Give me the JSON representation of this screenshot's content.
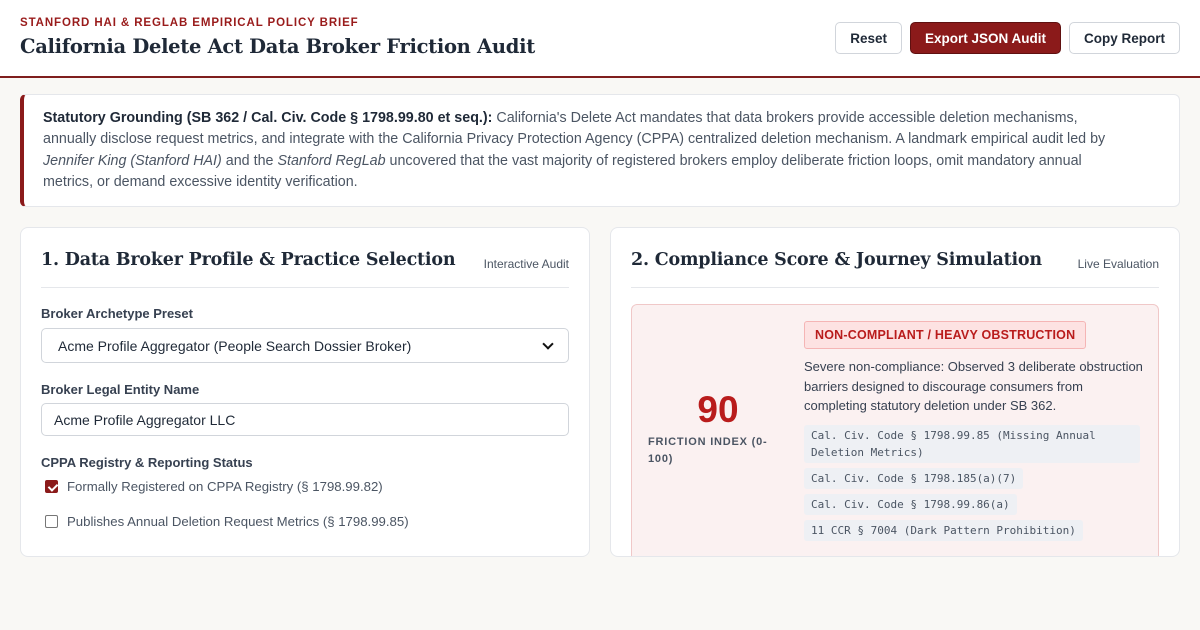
{
  "header": {
    "eyebrow": "STANFORD HAI & REGLAB EMPIRICAL POLICY BRIEF",
    "title": "California Delete Act Data Broker Friction Audit",
    "actions": {
      "reset": "Reset",
      "export": "Export JSON Audit",
      "copy": "Copy Report"
    }
  },
  "grounding": {
    "lead": "Statutory Grounding (SB 362 / Cal. Civ. Code § 1798.99.80 et seq.):",
    "text_1": " California's Delete Act mandates that data brokers provide accessible deletion mechanisms, annually disclose request metrics, and integrate with the California Privacy Protection Agency (CPPA) centralized deletion mechanism. A landmark empirical audit led by ",
    "person": "Jennifer King (Stanford HAI)",
    "text_2": " and the ",
    "lab": "Stanford RegLab",
    "text_3": " uncovered that the vast majority of registered brokers employ deliberate friction loops, omit mandatory annual metrics, or demand excessive identity verification."
  },
  "left_panel": {
    "title": "1. Data Broker Profile & Practice Selection",
    "tag": "Interactive Audit",
    "preset_label": "Broker Archetype Preset",
    "preset_value": "Acme Profile Aggregator (People Search Dossier Broker)",
    "entity_label": "Broker Legal Entity Name",
    "entity_value": "Acme Profile Aggregator LLC",
    "registry_label": "CPPA Registry & Reporting Status",
    "checks": [
      {
        "label": "Formally Registered on CPPA Registry (§ 1798.99.82)",
        "checked": true
      },
      {
        "label": "Publishes Annual Deletion Request Metrics (§ 1798.99.85)",
        "checked": false
      }
    ]
  },
  "right_panel": {
    "title": "2. Compliance Score & Journey Simulation",
    "tag": "Live Evaluation",
    "score": "90",
    "score_label": "FRICTION INDEX (0-100)",
    "status": "NON-COMPLIANT / HEAVY OBSTRUCTION",
    "verdict": "Severe non-compliance: Observed 3 deliberate obstruction barriers designed to discourage consumers from completing statutory deletion under SB 362.",
    "citations": [
      "Cal. Civ. Code § 1798.99.85 (Missing Annual Deletion Metrics)",
      "Cal. Civ. Code § 1798.185(a)(7)",
      "Cal. Civ. Code § 1798.99.86(a)",
      "11 CCR § 7004 (Dark Pattern Prohibition)"
    ]
  },
  "colors": {
    "accent": "#8b1a1a",
    "danger": "#b91c1c",
    "page_bg": "#f9f8f5"
  }
}
